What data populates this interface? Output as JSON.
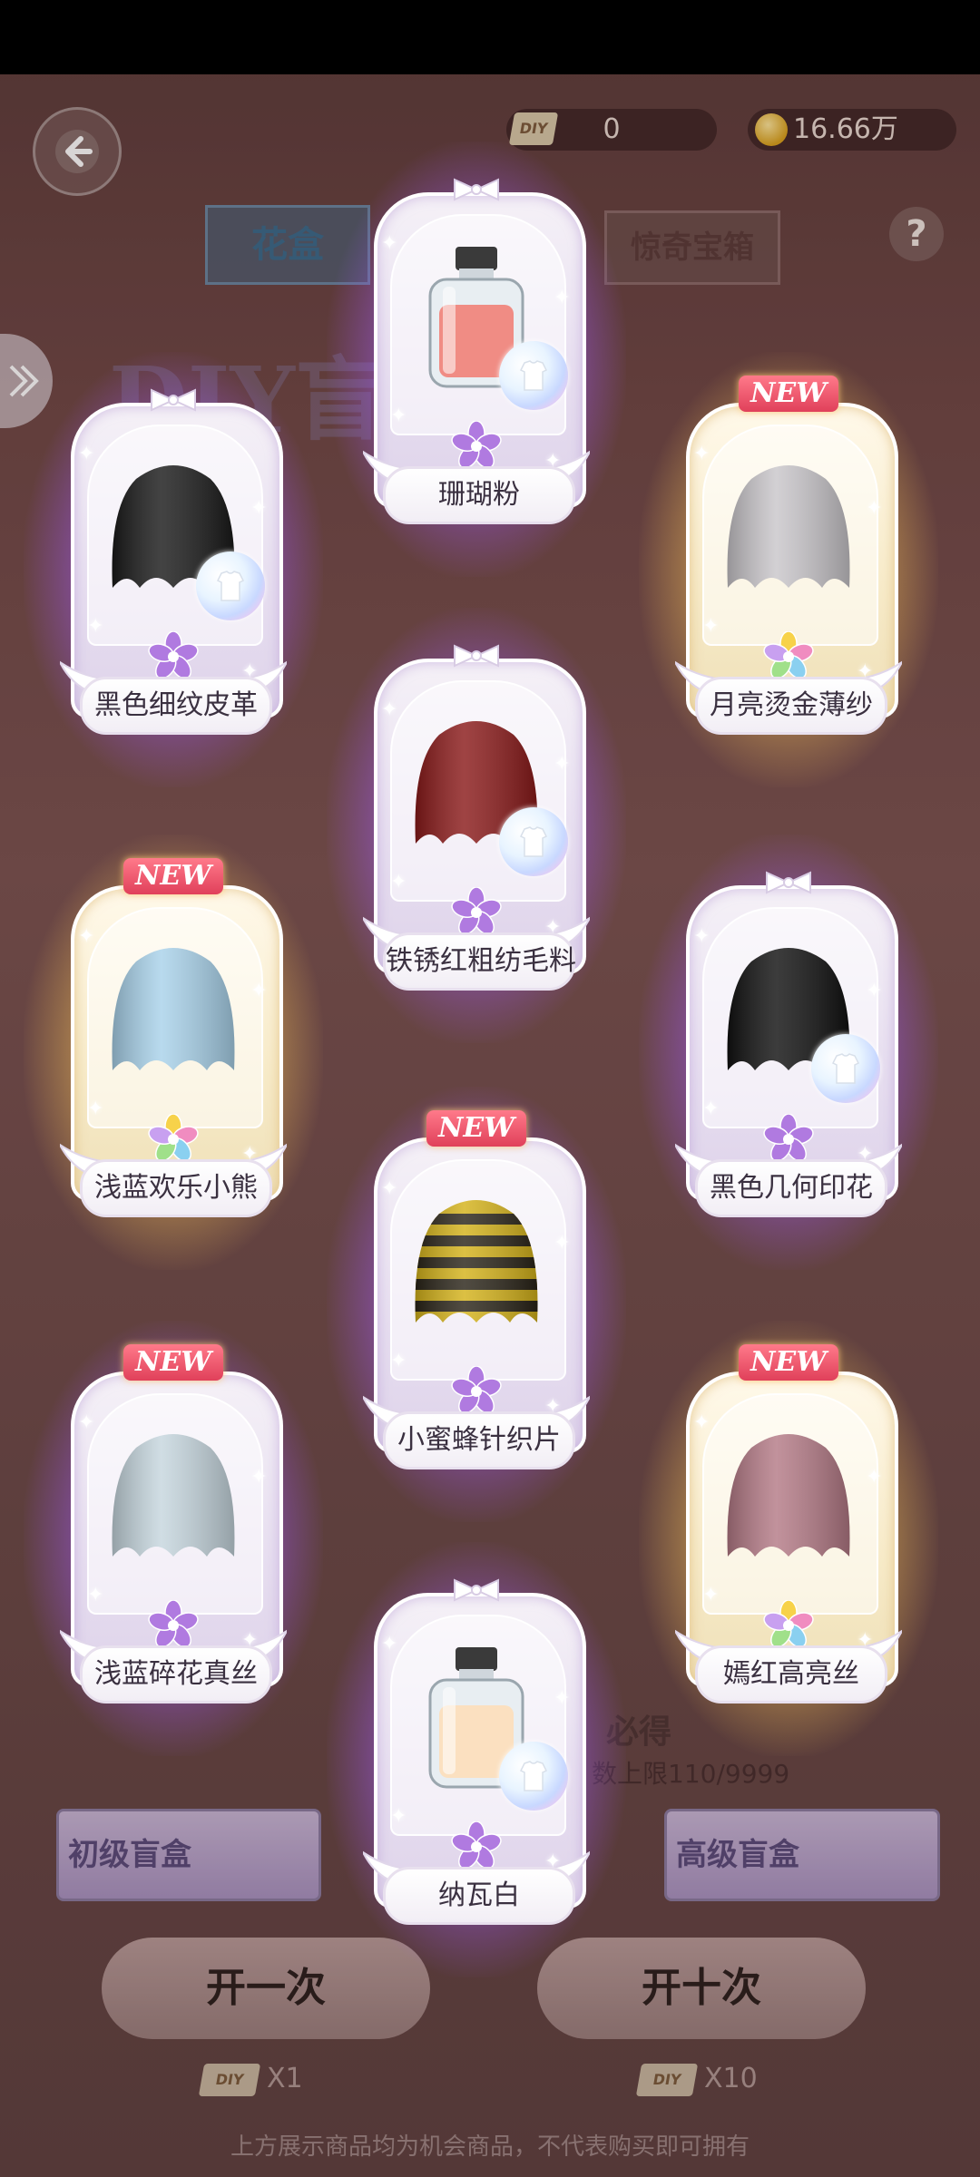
{
  "header": {
    "diy_count": "0",
    "diy_tag": "DIY",
    "gold_amount": "16.66万",
    "tab_flower": "花盒",
    "tab_chest": "惊奇宝箱",
    "help_icon": "?",
    "title_bg": "DIY盲"
  },
  "cards": [
    {
      "label": "珊瑚粉",
      "is_new": false,
      "kind": "bottle",
      "color": "#f08c84",
      "tier": "purple",
      "badge": true
    },
    {
      "label": "黑色细纹皮革",
      "is_new": false,
      "kind": "cloth",
      "color": "#1a1a1a",
      "tier": "purple",
      "badge": true
    },
    {
      "label": "月亮烫金薄纱",
      "is_new": true,
      "new_text": "NEW",
      "kind": "cloth",
      "color": "#c9c6ca",
      "tier": "gold",
      "badge": false
    },
    {
      "label": "铁锈红粗纺毛料",
      "is_new": false,
      "kind": "cloth",
      "color": "#8a1a1a",
      "tier": "purple",
      "badge": true
    },
    {
      "label": "浅蓝欢乐小熊",
      "is_new": true,
      "new_text": "NEW",
      "kind": "cloth",
      "color": "#a9d2ea",
      "tier": "gold",
      "badge": false
    },
    {
      "label": "黑色几何印花",
      "is_new": false,
      "kind": "cloth",
      "color": "#111111",
      "tier": "purple",
      "badge": true
    },
    {
      "label": "小蜜蜂针织片",
      "is_new": true,
      "new_text": "NEW",
      "kind": "stripe",
      "color": "#d4b21a",
      "tier": "purple",
      "badge": false
    },
    {
      "label": "浅蓝碎花真丝",
      "is_new": true,
      "new_text": "NEW",
      "kind": "cloth",
      "color": "#c6d6de",
      "tier": "purple",
      "badge": false
    },
    {
      "label": "嫣红高亮丝",
      "is_new": true,
      "new_text": "NEW",
      "kind": "cloth",
      "color": "#b47a86",
      "tier": "gold",
      "badge": false
    },
    {
      "label": "纳瓦白",
      "is_new": false,
      "kind": "bottle",
      "color": "#fbe0c0",
      "tier": "purple",
      "badge": true
    }
  ],
  "bottom": {
    "info_title": "必得",
    "info_limit": "数上限110/9999",
    "primary_box": "初级盲盒",
    "advanced_box": "高级盲盒",
    "open_once": "开一次",
    "open_ten": "开十次",
    "cost_once": "X1",
    "cost_ten": "X10",
    "disclaimer": "上方展示商品均为机会商品，不代表购买即可拥有"
  }
}
